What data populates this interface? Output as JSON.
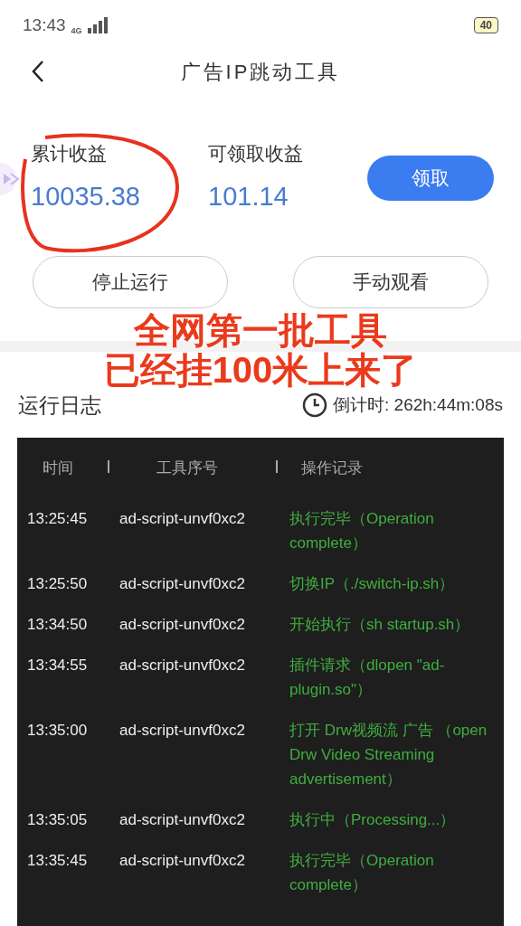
{
  "status_bar": {
    "time": "13:43",
    "network": "4G",
    "battery": "40"
  },
  "header": {
    "title": "广告IP跳动工具"
  },
  "stats": [
    {
      "label": "累计收益",
      "value": "10035.38"
    },
    {
      "label": "可领取收益",
      "value": "101.14"
    }
  ],
  "claim_button": "领取",
  "actions": [
    "停止运行",
    "手动观看"
  ],
  "log": {
    "title": "运行日志",
    "countdown": "倒计时: 262h:44m:08s",
    "columns": [
      "时间",
      "工具序号",
      "操作记录"
    ],
    "rows": [
      {
        "time": "13:25:45",
        "tool": "ad-script-unvf0xc2",
        "record": "执行完毕（Operation complete）"
      },
      {
        "time": "13:25:50",
        "tool": "ad-script-unvf0xc2",
        "record": "切换IP（./switch-ip.sh）"
      },
      {
        "time": "13:34:50",
        "tool": "ad-script-unvf0xc2",
        "record": "开始执行（sh startup.sh）"
      },
      {
        "time": "13:34:55",
        "tool": "ad-script-unvf0xc2",
        "record": "插件请求（dlopen \"ad-plugin.so\"）"
      },
      {
        "time": "13:35:00",
        "tool": "ad-script-unvf0xc2",
        "record": "打开 Drw视频流 广告 （open Drw Video Streaming advertisement）"
      },
      {
        "time": "13:35:05",
        "tool": "ad-script-unvf0xc2",
        "record": "执行中（Processing...）"
      },
      {
        "time": "13:35:45",
        "tool": "ad-script-unvf0xc2",
        "record": "执行完毕（Operation complete）"
      }
    ]
  },
  "overlay": {
    "lines": [
      "全网第一批工具",
      "已经挂100米上来了"
    ]
  }
}
